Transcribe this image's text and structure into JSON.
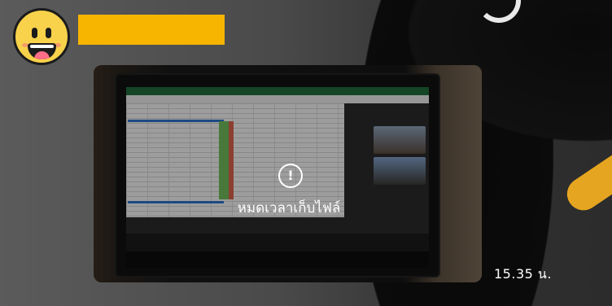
{
  "message": {
    "error_icon": "exclamation-circle-icon",
    "error_text": "หมดเวลาเก็บไฟล์",
    "timestamp": "15.35 น."
  },
  "sender": {
    "avatar_icon": "laughing-face-emoji-icon",
    "name_bar_color": "#f7b500"
  }
}
